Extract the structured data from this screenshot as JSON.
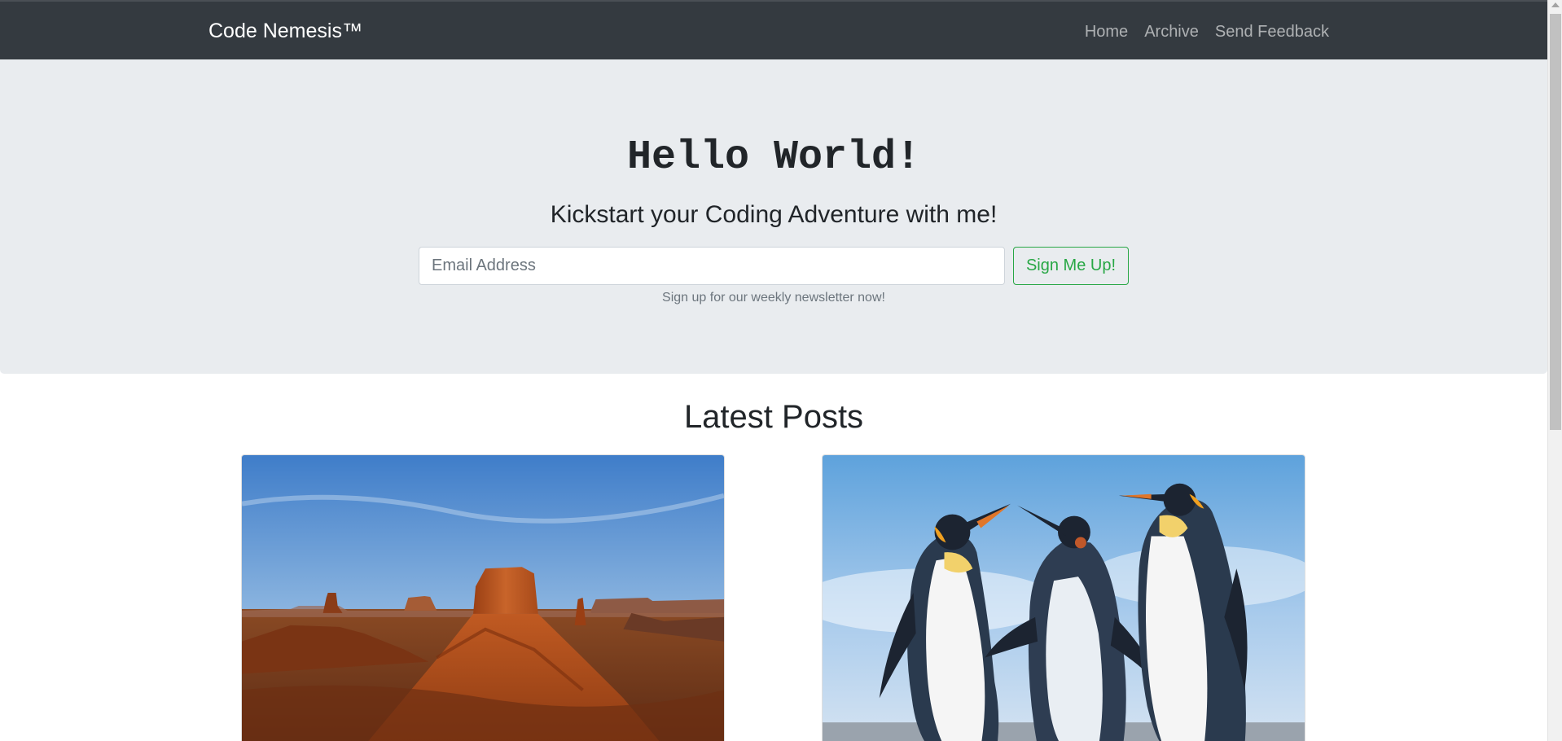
{
  "navbar": {
    "brand": "Code Nemesis™",
    "links": [
      "Home",
      "Archive",
      "Send Feedback"
    ]
  },
  "hero": {
    "title": "Hello World!",
    "subtitle": "Kickstart your Coding Adventure with me!",
    "email_placeholder": "Email Address",
    "signup_label": "Sign Me Up!",
    "help_text": "Sign up for our weekly newsletter now!"
  },
  "posts": {
    "title": "Latest Posts",
    "items": [
      {
        "image": "desert-mesa-photo"
      },
      {
        "image": "penguins-photo"
      }
    ]
  },
  "colors": {
    "navbar": "#343a40",
    "jumbotron": "#e9ecef",
    "success": "#28a745"
  }
}
